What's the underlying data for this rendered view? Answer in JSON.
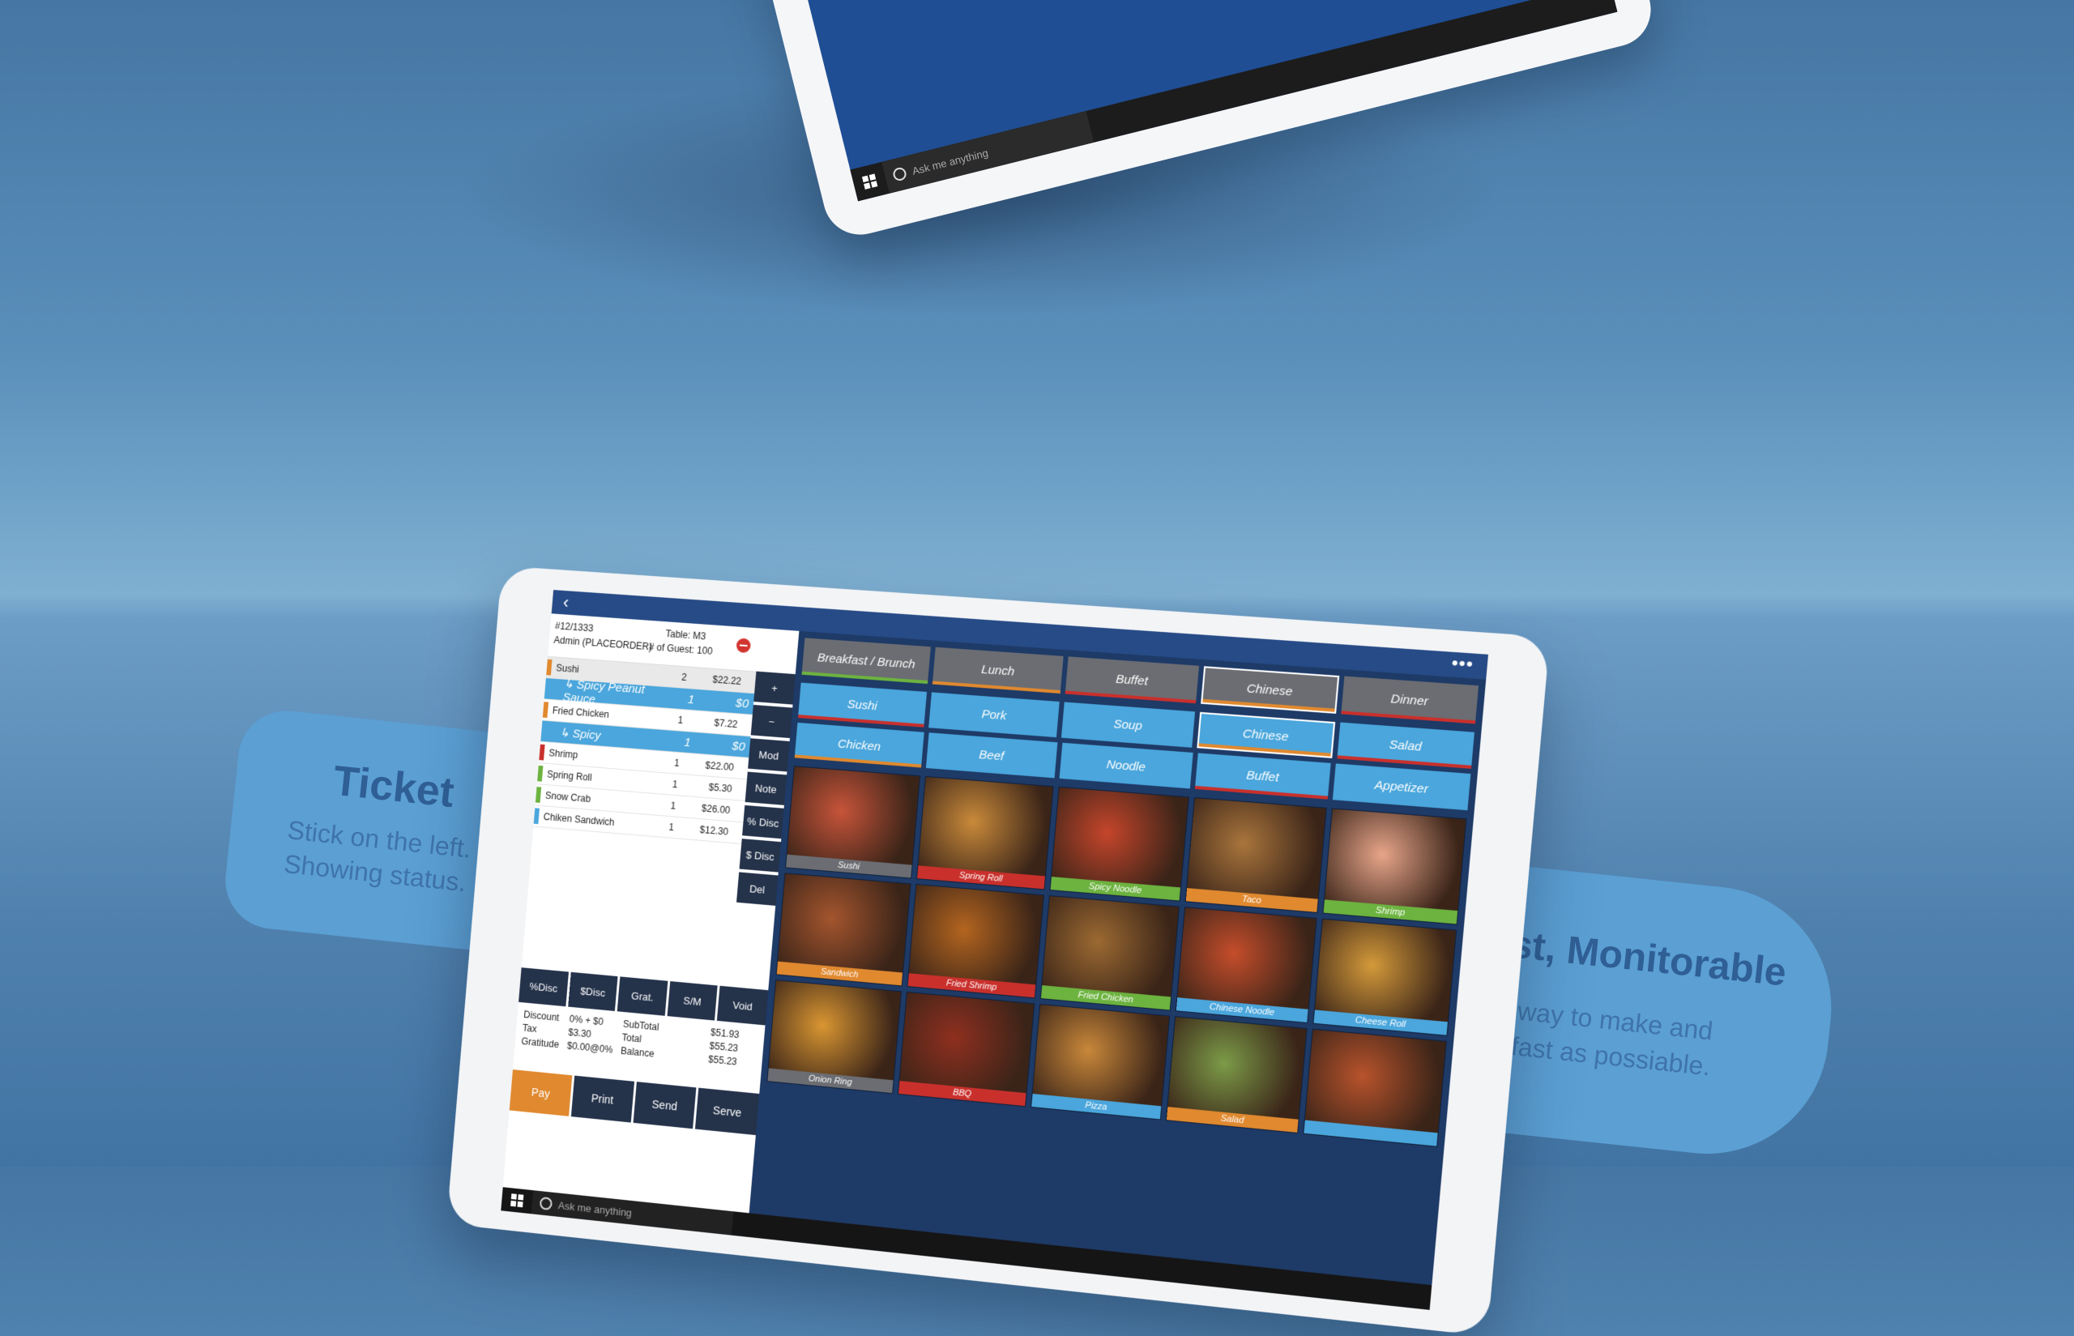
{
  "top_tablet": {
    "taskbar_search": "Ask me anything"
  },
  "ticket_callout": {
    "title": "Ticket",
    "line1": "Stick on the left.",
    "line2": "Showing status."
  },
  "easy_callout": {
    "title": "Eassy, Fast, Monitorable",
    "line1": "Find the easiest way to make and",
    "line2": "edit an order as fast as possiable."
  },
  "ticket": {
    "order_id": "#12/1333",
    "user": "Admin (PLACEORDER)",
    "table": "Table: M3",
    "guests": "# of Guest: 100",
    "items": [
      {
        "name": "Sushi",
        "qty": "2",
        "price": "$22.22",
        "color": "#e0892f",
        "sub": false
      },
      {
        "name": "↳ Spicy Peanut Sauce",
        "qty": "1",
        "price": "$0",
        "color": "",
        "sub": true
      },
      {
        "name": "Fried Chicken",
        "qty": "1",
        "price": "$7.22",
        "color": "#e0892f",
        "sub": false
      },
      {
        "name": "↳ Spicy",
        "qty": "1",
        "price": "$0",
        "color": "",
        "sub": true
      },
      {
        "name": "Shrimp",
        "qty": "1",
        "price": "$22.00",
        "color": "#c9302c",
        "sub": false
      },
      {
        "name": "Spring Roll",
        "qty": "1",
        "price": "$5.30",
        "color": "#6cb33f",
        "sub": false
      },
      {
        "name": "Snow Crab",
        "qty": "1",
        "price": "$26.00",
        "color": "#6cb33f",
        "sub": false
      },
      {
        "name": "Chiken Sandwich",
        "qty": "1",
        "price": "$12.30",
        "color": "#4aa6dc",
        "sub": false
      }
    ],
    "side_buttons": [
      "+",
      "−",
      "Mod",
      "Note",
      "% Disc",
      "$ Disc",
      "Del"
    ],
    "bottom_buttons": [
      "%Disc",
      "$Disc",
      "Grat.",
      "S/M",
      "Void"
    ],
    "totals": {
      "discount_label": "Discount",
      "discount_value": "0% + $0",
      "tax_label": "Tax",
      "tax_value": "$3.30",
      "gratuity_label": "Gratitude",
      "gratuity_value": "$0.00@0%",
      "subtotal_label": "SubTotal",
      "subtotal_value": "$51.93",
      "total_label": "Total",
      "total_value": "$55.23",
      "balance_label": "Balance",
      "balance_value": "$55.23"
    },
    "actions": [
      "Pay",
      "Print",
      "Send",
      "Serve"
    ]
  },
  "menu": {
    "categories": [
      {
        "label": "Breakfast / Brunch",
        "underline": "#6cb33f"
      },
      {
        "label": "Lunch",
        "underline": "#e0892f"
      },
      {
        "label": "Buffet",
        "underline": "#c9302c"
      },
      {
        "label": "Chinese",
        "underline": "#e0892f",
        "active": true
      },
      {
        "label": "Dinner",
        "underline": "#c9302c"
      }
    ],
    "subcategories_row1": [
      {
        "label": "Sushi",
        "underline": "#c9302c"
      },
      {
        "label": "Pork",
        "underline": "#4aa6dc"
      },
      {
        "label": "Soup",
        "underline": "#4aa6dc"
      },
      {
        "label": "Chinese",
        "underline": "#e0892f",
        "active": true
      },
      {
        "label": "Salad",
        "underline": "#c9302c"
      }
    ],
    "subcategories_row2": [
      {
        "label": "Chicken",
        "underline": "#e0892f"
      },
      {
        "label": "Beef",
        "underline": "#4aa6dc"
      },
      {
        "label": "Noodle",
        "underline": "#4aa6dc"
      },
      {
        "label": "Buffet",
        "underline": "#c9302c"
      },
      {
        "label": "Appetizer",
        "underline": "#4aa6dc"
      }
    ],
    "foods": [
      {
        "label": "Sushi",
        "color": "#6b6d72",
        "img": "#c7543a"
      },
      {
        "label": "Spring Roll",
        "color": "#c9302c",
        "img": "#c98a3a"
      },
      {
        "label": "Spicy Noodle",
        "color": "#6cb33f",
        "img": "#c5452b"
      },
      {
        "label": "Taco",
        "color": "#e0892f",
        "img": "#a9753c"
      },
      {
        "label": "Shrimp",
        "color": "#6cb33f",
        "img": "#e7a58a"
      },
      {
        "label": "Sandwich",
        "color": "#e0892f",
        "img": "#a4552e"
      },
      {
        "label": "Fried Shrimp",
        "color": "#c9302c",
        "img": "#b4651f"
      },
      {
        "label": "Fried Chicken",
        "color": "#6cb33f",
        "img": "#9c6a32"
      },
      {
        "label": "Chinese Noodle",
        "color": "#4aa6dc",
        "img": "#c54d2b"
      },
      {
        "label": "Cheese Roll",
        "color": "#4aa6dc",
        "img": "#d49a3a"
      },
      {
        "label": "Onion Ring",
        "color": "#6b6d72",
        "img": "#d99632"
      },
      {
        "label": "BBQ",
        "color": "#c9302c",
        "img": "#8f2f1f"
      },
      {
        "label": "Pizza",
        "color": "#4aa6dc",
        "img": "#c9883a"
      },
      {
        "label": "Salad",
        "color": "#e0892f",
        "img": "#7c9b48"
      },
      {
        "label": "",
        "color": "#4aa6dc",
        "img": "#b8532c"
      }
    ]
  },
  "taskbar": {
    "search": "Ask me anything"
  }
}
